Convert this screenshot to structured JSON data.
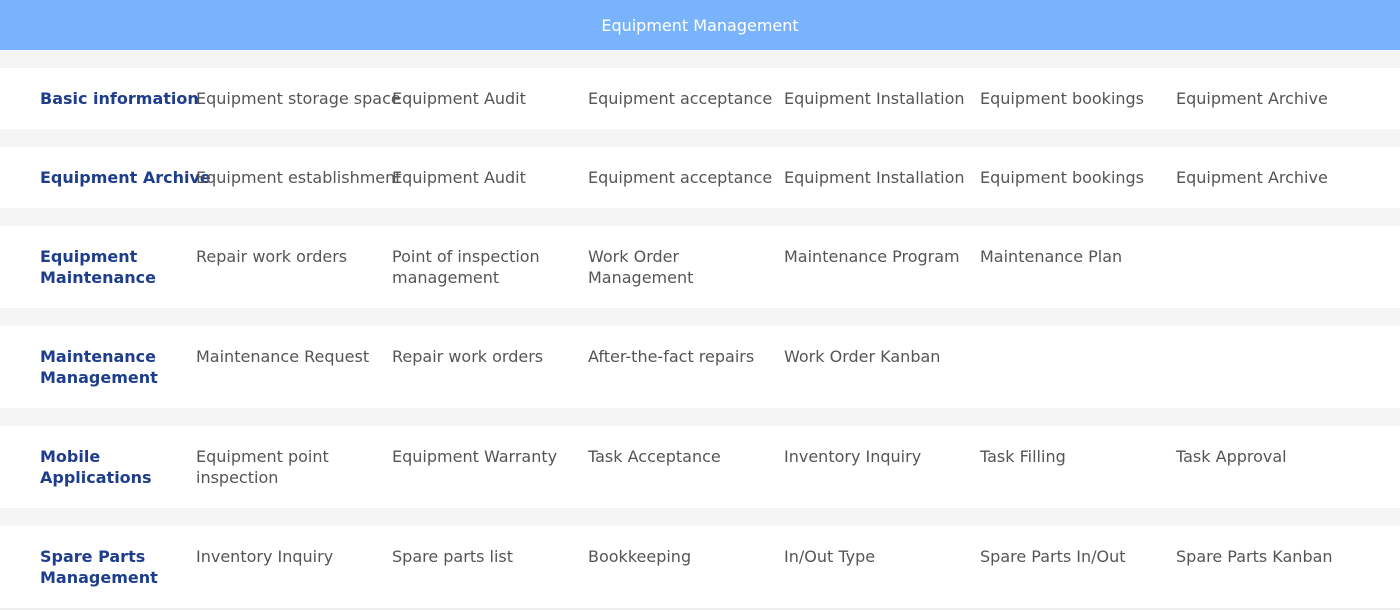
{
  "header": {
    "title": "Equipment Management"
  },
  "sections": [
    {
      "title": "Basic information",
      "items": [
        "Equipment storage space",
        "Equipment Audit",
        "Equipment acceptance",
        "Equipment Installation",
        "Equipment bookings",
        "Equipment Archive"
      ]
    },
    {
      "title": "Equipment Archive",
      "items": [
        "Equipment establishment",
        "Equipment Audit",
        "Equipment acceptance",
        "Equipment Installation",
        "Equipment bookings",
        "Equipment Archive"
      ]
    },
    {
      "title": "Equipment Maintenance",
      "items": [
        "Repair work orders",
        "Point of inspection management",
        "Work Order Management",
        "Maintenance Program",
        "Maintenance Plan"
      ]
    },
    {
      "title": "Maintenance Management",
      "items": [
        "Maintenance Request",
        "Repair work orders",
        "After-the-fact repairs",
        "Work Order Kanban"
      ]
    },
    {
      "title": "Mobile Applications",
      "items": [
        "Equipment point inspection",
        "Equipment Warranty",
        "Task Acceptance",
        "Inventory Inquiry",
        "Task Filling",
        "Task Approval"
      ]
    },
    {
      "title": "Spare Parts Management",
      "items": [
        "Inventory Inquiry",
        "Spare parts list",
        "Bookkeeping",
        "In/Out Type",
        "Spare Parts In/Out",
        "Spare Parts Kanban"
      ]
    }
  ]
}
